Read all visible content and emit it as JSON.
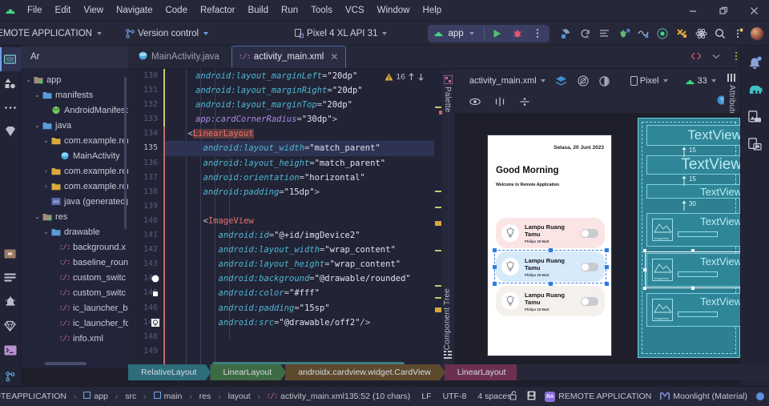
{
  "window": {
    "minimize_label": "–",
    "maximize_label": "❐",
    "close_label": "✕"
  },
  "menubar": {
    "items": [
      "File",
      "Edit",
      "View",
      "Navigate",
      "Code",
      "Refactor",
      "Build",
      "Run",
      "Tools",
      "VCS",
      "Window",
      "Help"
    ]
  },
  "toolbar": {
    "project_name": "REMOTE APPLICATION",
    "version_control": "Version control",
    "device": "Pixel 4 XL API 31",
    "run_config": "app",
    "icons": [
      "build-hammer-icon",
      "sync-gradle-icon",
      "code-format-icon",
      "run-debug-icon",
      "profile-icon",
      "record-icon",
      "tools-icon",
      "atom-icon",
      "search-icon",
      "more-updates-icon"
    ]
  },
  "leftbar": {
    "items": [
      {
        "name": "project-tool-icon",
        "label": "Project"
      },
      {
        "name": "resource-manager-icon",
        "label": "Resource Manager"
      },
      {
        "name": "more-tools-icon",
        "label": "More Tool Windows"
      },
      {
        "name": "bookmarks-icon",
        "label": "Bookmarks"
      },
      {
        "name": "build-variants-icon",
        "label": "Build Variants"
      },
      {
        "name": "build-icon",
        "label": "Build"
      },
      {
        "name": "notifications-icon",
        "label": "Notifications"
      },
      {
        "name": "app-quality-icon",
        "label": "App Quality Insights"
      },
      {
        "name": "terminal-icon",
        "label": "Terminal"
      },
      {
        "name": "version-control-icon",
        "label": "Version Control"
      }
    ]
  },
  "rightbar": {
    "items": [
      {
        "name": "notifications-bell-icon",
        "label": "Notifications"
      },
      {
        "name": "gradle-elephant-icon",
        "label": "Gradle"
      },
      {
        "name": "device-manager-icon",
        "label": "Device Manager"
      },
      {
        "name": "running-devices-icon",
        "label": "Running Devices"
      }
    ]
  },
  "project": {
    "title": "Ar",
    "tree": [
      {
        "depth": 0,
        "arrow": "⌄",
        "icon": "module-icon",
        "label": "app"
      },
      {
        "depth": 1,
        "arrow": "⌄",
        "icon": "folder-icon",
        "label": "manifests"
      },
      {
        "depth": 2,
        "arrow": "",
        "icon": "android-file-icon",
        "label": "AndroidManifest"
      },
      {
        "depth": 1,
        "arrow": "⌄",
        "icon": "folder-icon",
        "label": "java"
      },
      {
        "depth": 2,
        "arrow": "⌄",
        "icon": "package-icon",
        "label": "com.example.rem"
      },
      {
        "depth": 3,
        "arrow": "",
        "icon": "java-class-icon",
        "label": "MainActivity"
      },
      {
        "depth": 2,
        "arrow": "›",
        "icon": "package-icon",
        "label": "com.example.rem"
      },
      {
        "depth": 2,
        "arrow": "›",
        "icon": "package-icon",
        "label": "com.example.rem"
      },
      {
        "depth": 2,
        "arrow": "",
        "icon": "generated-java-icon",
        "label": "java (generated)"
      },
      {
        "depth": 1,
        "arrow": "⌄",
        "icon": "res-folder-icon",
        "label": "res"
      },
      {
        "depth": 2,
        "arrow": "⌄",
        "icon": "folder-icon",
        "label": "drawable"
      },
      {
        "depth": 3,
        "arrow": "",
        "icon": "xml-file-icon",
        "label": "background.x"
      },
      {
        "depth": 3,
        "arrow": "",
        "icon": "xml-file-icon",
        "label": "baseline_roun"
      },
      {
        "depth": 3,
        "arrow": "",
        "icon": "xml-file-icon",
        "label": "custom_switc"
      },
      {
        "depth": 3,
        "arrow": "",
        "icon": "xml-file-icon",
        "label": "custom_switc"
      },
      {
        "depth": 3,
        "arrow": "",
        "icon": "xml-file-icon",
        "label": "ic_launcher_b"
      },
      {
        "depth": 3,
        "arrow": "",
        "icon": "xml-file-icon",
        "label": "ic_launcher_fc"
      },
      {
        "depth": 3,
        "arrow": "",
        "icon": "xml-file-icon",
        "label": "info.xml"
      }
    ]
  },
  "tabs": [
    {
      "label": "MainActivity.java",
      "icon": "java-class-icon",
      "active": false,
      "closable": false
    },
    {
      "label": "activity_main.xml",
      "icon": "xml-file-icon",
      "active": true,
      "closable": true
    }
  ],
  "editor": {
    "warning_count": "16",
    "warning_icon": "warning-triangle-icon",
    "first_line": 130,
    "selected_line": 135,
    "lines": [
      {
        "num": "130",
        "indent": 4,
        "html": "<span class=\"c-attr\">android:layout_marginLeft</span>=<span class=\"c-val\">\"20dp\"</span>"
      },
      {
        "num": "131",
        "indent": 4,
        "html": "<span class=\"c-attr\">android:layout_marginRight</span>=<span class=\"c-val\">\"20dp\"</span>"
      },
      {
        "num": "132",
        "indent": 4,
        "html": "<span class=\"c-attr\">android:layout_marginTop</span>=<span class=\"c-val\">\"20dp\"</span>"
      },
      {
        "num": "133",
        "indent": 4,
        "html": "<span class=\"c-app\">app:cardCornerRadius</span>=<span class=\"c-val\">\"30dp\"</span>&gt;"
      },
      {
        "num": "134",
        "indent": 3,
        "html": "&lt;<span class=\"c-tag err\">LinearLayout</span>"
      },
      {
        "num": "135",
        "indent": 5,
        "html": "<span class=\"c-attr\">android:layout_width</span>=<span class=\"c-val\">\"match_parent\"</span>"
      },
      {
        "num": "136",
        "indent": 5,
        "html": "<span class=\"c-attr\">android:layout_height</span>=<span class=\"c-val\">\"match_parent\"</span>"
      },
      {
        "num": "137",
        "indent": 5,
        "html": "<span class=\"c-attr\">android:orientation</span>=<span class=\"c-val\">\"horizontal\"</span>"
      },
      {
        "num": "138",
        "indent": 5,
        "html": "<span class=\"c-attr\">android:padding</span>=<span class=\"c-val\">\"15dp\"</span>&gt;"
      },
      {
        "num": "139",
        "indent": 0,
        "html": ""
      },
      {
        "num": "140",
        "indent": 5,
        "html": "&lt;<span class=\"c-tag\">ImageView</span>"
      },
      {
        "num": "141",
        "indent": 7,
        "html": "<span class=\"c-attr\">android:id</span>=<span class=\"c-val\">\"@+id/imgDevice2\"</span>"
      },
      {
        "num": "142",
        "indent": 7,
        "html": "<span class=\"c-attr\">android:layout_width</span>=<span class=\"c-val\">\"wrap_content\"</span>"
      },
      {
        "num": "143",
        "indent": 7,
        "html": "<span class=\"c-attr\">android:layout_height</span>=<span class=\"c-val\">\"wrap_content\"</span>"
      },
      {
        "num": "144",
        "indent": 7,
        "html": "<span class=\"c-attr\">android:background</span>=<span class=\"c-val\">\"@drawable/rounded\"</span>"
      },
      {
        "num": "145",
        "indent": 7,
        "html": "<span class=\"c-attr\">android:color</span>=<span class=\"c-val\">\"#fff\"</span>"
      },
      {
        "num": "146",
        "indent": 7,
        "html": "<span class=\"c-attr\">android:padding</span>=<span class=\"c-val\">\"15sp\"</span>"
      },
      {
        "num": "147",
        "indent": 7,
        "html": "<span class=\"c-attr\">android:src</span>=<span class=\"c-val\">\"@drawable/off2\"</span>/&gt;"
      },
      {
        "num": "148",
        "indent": 0,
        "html": ""
      },
      {
        "num": "149",
        "indent": 0,
        "html": ""
      }
    ]
  },
  "design": {
    "file_label": "activity_main.xml",
    "mode_icons": [
      "design-mode-icon",
      "blueprint-mode-icon",
      "force-refresh-icon"
    ],
    "device_label": "Pixel",
    "api_label": "33",
    "more_label": "⋯",
    "issue_icon": "warning-triangle-icon",
    "attributes_label": "Attributes",
    "palette_label": "Palette",
    "component_tree_label": "Component Tree",
    "row2_icons": [
      "eye-icon",
      "align-horizontal-icon",
      "align-vertical-icon"
    ],
    "help_icon": "help-circle-icon"
  },
  "preview": {
    "date": "Selasa, 20 Juni 2023",
    "greeting": "Good Morning",
    "subtitle": "Welcome to Remote Application",
    "cards": [
      {
        "name": "Lampu Ruang Tamu",
        "sub": "Philips 18 Watt",
        "bg": "#fbe4e4",
        "selected": false
      },
      {
        "name": "Lampu Ruang Tamu",
        "sub": "Philips 18 Watt",
        "bg": "#d6eaf9",
        "selected": true
      },
      {
        "name": "Lampu Ruang Tamu",
        "sub": "Philips 18 Watt",
        "bg": "#f4f1ec",
        "selected": false
      }
    ]
  },
  "blueprint": {
    "textviews": [
      "TextView",
      "TextView",
      "TextView"
    ],
    "margins": [
      "15",
      "15",
      "30"
    ],
    "card_labels": [
      "TextView",
      "TextView",
      "TextView"
    ],
    "image_label": "ImageView"
  },
  "breadcrumbs": {
    "items": [
      {
        "label": "RelativeLayout",
        "color": "#2d6d7a"
      },
      {
        "label": "LinearLayout",
        "color": "#3d6b45"
      },
      {
        "label": "androidx.cardview.widget.CardView",
        "color": "#5d4a2c"
      },
      {
        "label": "LinearLayout",
        "color": "#6b3050"
      }
    ]
  },
  "statusbar": {
    "path": [
      "MOTEAPPLICATION",
      "app",
      "src",
      "main",
      "res",
      "layout",
      "activity_main.xml"
    ],
    "caret": "135:52 (10 chars)",
    "line_sep": "LF",
    "encoding": "UTF-8",
    "indent": "4 spaces",
    "lock_icon": "lock-open-icon",
    "memory_icon": "save-icon",
    "project_badge": "RA",
    "project_name": "REMOTE APPLICATION",
    "theme_icon": "material-theme-icon",
    "theme": "Moonlight (Material)",
    "status_dot_color": "#5e8ee0"
  }
}
